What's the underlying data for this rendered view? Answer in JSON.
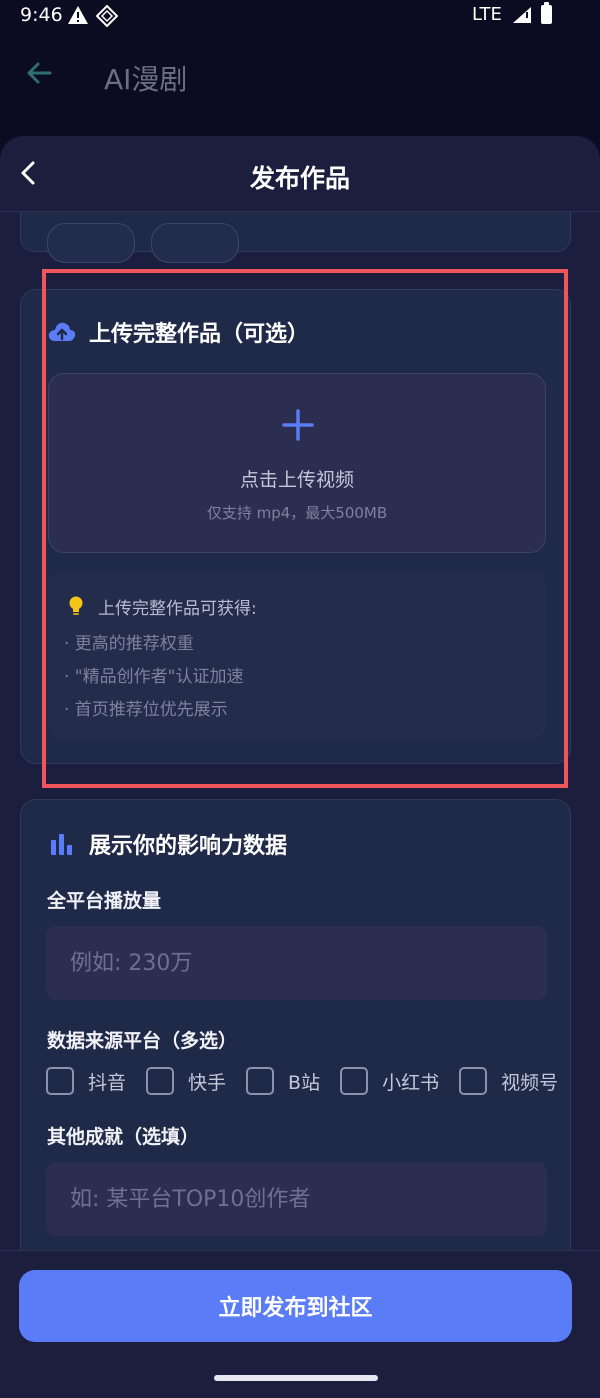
{
  "status_bar": {
    "time": "9:46",
    "network": "LTE"
  },
  "app_bar": {
    "title": "AI漫剧"
  },
  "sheet": {
    "title": "发布作品"
  },
  "upload_section": {
    "title": "上传完整作品（可选）",
    "upload_label": "点击上传视频",
    "upload_hint": "仅支持 mp4，最大500MB",
    "tips_title": "上传完整作品可获得:",
    "tips": [
      "· 更高的推荐权重",
      "· \"精品创作者\"认证加速",
      "· 首页推荐位优先展示"
    ]
  },
  "influence_section": {
    "title": "展示你的影响力数据",
    "views_label": "全平台播放量",
    "views_placeholder": "例如: 230万",
    "platforms_label": "数据来源平台（多选）",
    "platforms": [
      "抖音",
      "快手",
      "B站",
      "小红书",
      "视频号"
    ],
    "achievements_label": "其他成就（选填）",
    "achievements_placeholder": "如: 某平台TOP10创作者"
  },
  "actions": {
    "publish_label": "立即发布到社区"
  },
  "colors": {
    "accent": "#5b7cf7",
    "highlight_border": "#f0555c",
    "tip_bulb": "#f5c518"
  }
}
